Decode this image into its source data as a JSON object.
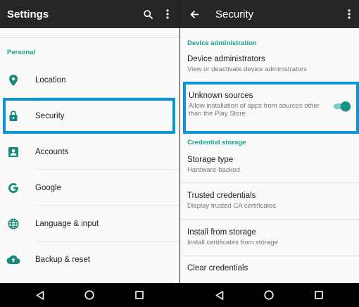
{
  "left": {
    "appbar": {
      "title": "Settings",
      "search_icon": "search-icon",
      "menu_icon": "more-vert-icon"
    },
    "section": "Personal",
    "items": [
      {
        "label": "Location",
        "icon": "location-pin-icon"
      },
      {
        "label": "Security",
        "icon": "lock-icon"
      },
      {
        "label": "Accounts",
        "icon": "account-box-icon"
      },
      {
        "label": "Google",
        "icon": "google-g-icon"
      },
      {
        "label": "Language & input",
        "icon": "globe-icon"
      },
      {
        "label": "Backup & reset",
        "icon": "cloud-upload-icon"
      }
    ]
  },
  "right": {
    "appbar": {
      "title": "Security",
      "back_icon": "back-arrow-icon",
      "menu_icon": "more-vert-icon"
    },
    "device_admin_section": "Device administration",
    "device_admins": {
      "title": "Device administrators",
      "subtitle": "View or deactivate device administrators"
    },
    "unknown_sources": {
      "title": "Unknown sources",
      "subtitle": "Allow installation of apps from sources other than the Play Store",
      "enabled": true
    },
    "credential_section": "Credential storage",
    "storage_type": {
      "title": "Storage type",
      "subtitle": "Hardware-backed"
    },
    "trusted_credentials": {
      "title": "Trusted credentials",
      "subtitle": "Display trusted CA certificates"
    },
    "install_from_storage": {
      "title": "Install from storage",
      "subtitle": "Install certificates from storage"
    },
    "clear_credentials": {
      "title": "Clear credentials"
    }
  },
  "navbar": {
    "back_icon": "nav-back-icon",
    "home_icon": "nav-home-icon",
    "recents_icon": "nav-recents-icon"
  },
  "colors": {
    "accent": "#1a9e8e",
    "toggle_on": "#139488",
    "highlight": "#0a95d8",
    "appbar": "#262626",
    "icon": "#17887c"
  }
}
